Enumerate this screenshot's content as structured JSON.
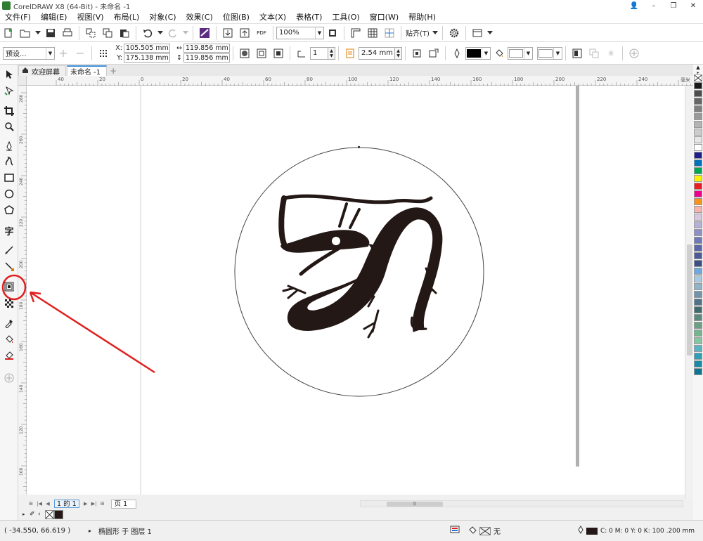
{
  "window": {
    "title": "CorelDRAW X8 (64-Bit) - 未命名 -1",
    "controls": [
      "👤",
      "–",
      "❐",
      "✕"
    ]
  },
  "menu": [
    "文件(F)",
    "编辑(E)",
    "视图(V)",
    "布局(L)",
    "对象(C)",
    "效果(C)",
    "位图(B)",
    "文本(X)",
    "表格(T)",
    "工具(O)",
    "窗口(W)",
    "帮助(H)"
  ],
  "toolbar": {
    "zoom": "100%",
    "snap_label": "贴齐(T)",
    "pdf_label": "PDF"
  },
  "property_bar": {
    "preset": "预设...",
    "x_label": "X:",
    "x_value": "105.505 mm",
    "y_label": "Y:",
    "y_value": "175.138 mm",
    "w_value": "119.856 mm",
    "h_value": "119.856 mm",
    "count_value": "1",
    "outline_width": "2.54 mm"
  },
  "tabs": [
    {
      "label": "欢迎屏幕",
      "icon": "home-icon"
    },
    {
      "label": "未命名 -1",
      "active": true
    }
  ],
  "ruler": {
    "h_ticks": [
      "40",
      "20",
      "0",
      "20",
      "40",
      "60",
      "80",
      "100",
      "120",
      "140",
      "160",
      "180",
      "200",
      "220",
      "240"
    ],
    "unit": "毫米",
    "v_ticks": [
      "280",
      "260",
      "240",
      "220",
      "200",
      "180",
      "160",
      "140",
      "120",
      "100",
      "80"
    ]
  },
  "page_nav": {
    "count": "1 的 1",
    "page_tab": "页 1"
  },
  "status": {
    "cursor": "( -34.550, 66.619 )",
    "selection": "椭圆形 于 图层 1",
    "fill_none": "无",
    "outline": "C: 0 M: 0 Y: 0 K: 100  .200 mm"
  },
  "colors": {
    "accent": "#3d8fd6",
    "annotation_red": "#e0201f",
    "ink": "#231815"
  },
  "palette": [
    "#1a1a1a",
    "#4d4d4d",
    "#666666",
    "#808080",
    "#999999",
    "#b3b3b3",
    "#cccccc",
    "#e6e6e6",
    "#ffffff",
    "#1f1f8c",
    "#0072bc",
    "#00a651",
    "#fff200",
    "#ed1c24",
    "#ec008c",
    "#f7941d",
    "#f9b4ad",
    "#d7c7e0",
    "#b5b0d6",
    "#8e8fc7",
    "#7078b8",
    "#5a66a8",
    "#4b5b96",
    "#3c4f84",
    "#6fa8dc",
    "#a9c8e2",
    "#8fb3c9",
    "#7095ab",
    "#4f7489",
    "#3f6a6e",
    "#5b8a7d",
    "#6aa084",
    "#76b38f",
    "#86c7a3",
    "#5ab3c3",
    "#2f9fb6",
    "#1b8aa6",
    "#0f7592"
  ]
}
